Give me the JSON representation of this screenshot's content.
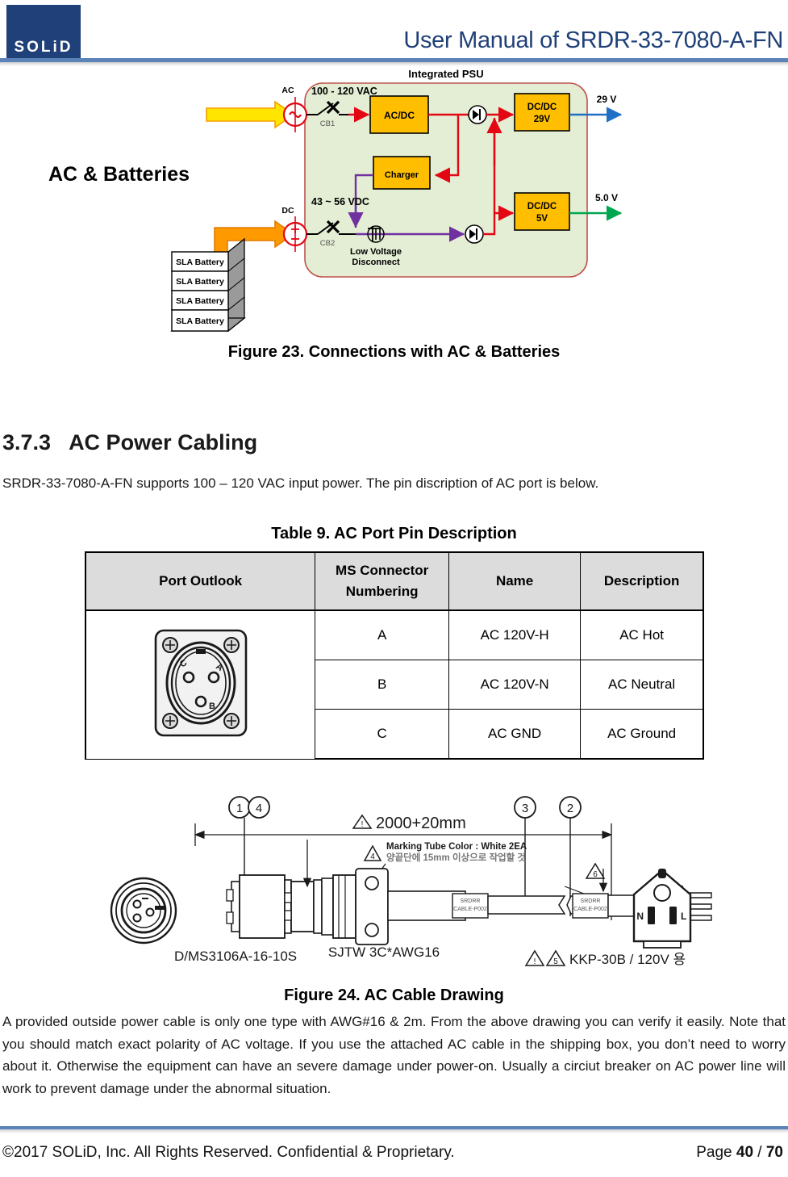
{
  "header": {
    "logo_text": "SOLiD",
    "title": "User Manual of SRDR-33-7080-A-FN"
  },
  "figure23": {
    "caption": "Figure 23. Connections with AC & Batteries",
    "psu_title": "Integrated PSU",
    "left_label": "AC & Batteries",
    "ac_port_label": "AC",
    "dc_port_label": "DC",
    "ac_voltage_label": "100 - 120  VAC",
    "dc_voltage_label": "43 ~ 56 VDC",
    "breaker1_label": "CB1",
    "breaker2_label": "CB2",
    "block_acdc": "AC/DC",
    "block_charger": "Charger",
    "block_dcdc29_line1": "DC/DC",
    "block_dcdc29_line2": "29V",
    "block_dcdc5_line1": "DC/DC",
    "block_dcdc5_line2": "5V",
    "lvd_line1": "Low Voltage",
    "lvd_line2": "Disconnect",
    "out29_label": "29 V",
    "out5_label": "5.0 V",
    "battery_label": "SLA Battery",
    "batteries": [
      "SLA Battery",
      "SLA Battery",
      "SLA Battery",
      "SLA Battery"
    ],
    "colors": {
      "psu_fill": "#e4eed4",
      "psu_border": "#c0504d",
      "block_fill": "#ffbf00",
      "block_border": "#000000",
      "red_wire": "#e30613",
      "purple_wire": "#7030a0",
      "blue_wire": "#1f6fc4",
      "green_wire": "#00a650",
      "ac_arrow": "#ffe500",
      "dc_arrow": "#ff9900",
      "source_ring": "#e30613"
    }
  },
  "section": {
    "number": "3.7.3",
    "title": "AC Power Cabling",
    "intro": "SRDR-33-7080-A-FN supports 100 – 120 VAC input power. The pin discription of AC port is below."
  },
  "table9": {
    "caption": "Table 9. AC Port Pin Description",
    "headers": [
      "Port Outlook",
      "MS Connector",
      "Numbering",
      "Name",
      "Description"
    ],
    "header_outlook": "Port Outlook",
    "header_ms_line1": "MS Connector",
    "header_ms_line2": "Numbering",
    "header_name": "Name",
    "header_desc": "Description",
    "connector_pins": [
      "A",
      "B",
      "C"
    ],
    "rows": [
      {
        "ms": "A",
        "name": "AC 120V-H",
        "desc": "AC Hot"
      },
      {
        "ms": "B",
        "name": "AC 120V-N",
        "desc": "AC Neutral"
      },
      {
        "ms": "C",
        "name": "AC GND",
        "desc": "AC Ground"
      }
    ]
  },
  "figure24": {
    "caption": "Figure 24. AC Cable Drawing",
    "balloon_1": "1",
    "balloon_2": "2",
    "balloon_3": "3",
    "balloon_4": "4",
    "balloon_5": "5",
    "balloon_6": "6",
    "dim_length": "2000+20mm",
    "note_tube_line1": "Marking Tube Color : White 2EA",
    "note_tube_line2": "양끝단에 15mm 이상으로 작업할 것",
    "connector_part": "D/MS3106A-16-10S",
    "cable_spec": "SJTW 3C*AWG16",
    "plug_spec": "KKP-30B / 120V 용",
    "tube_text_line1": "SRDRR",
    "tube_text_line2": "CABLE-P002",
    "plug_pin_n": "N",
    "plug_pin_l": "L"
  },
  "closing_paragraph": "A provided outside power cable is only one type with AWG#16 & 2m. From the above drawing you can verify it easily. Note that you should match exact polarity of AC voltage. If you use the attached AC cable in the shipping box, you don’t need to worry about it. Otherwise the equipment can have an severe damage under power-on. Usually a circiut breaker on AC power line will work to prevent damage under the abnormal situation.",
  "footer": {
    "copyright": "©2017 SOLiD, Inc. All Rights Reserved. Confidential & Proprietary.",
    "page_prefix": "Page ",
    "page_number": "40",
    "page_separator": " / ",
    "page_total": "70"
  }
}
